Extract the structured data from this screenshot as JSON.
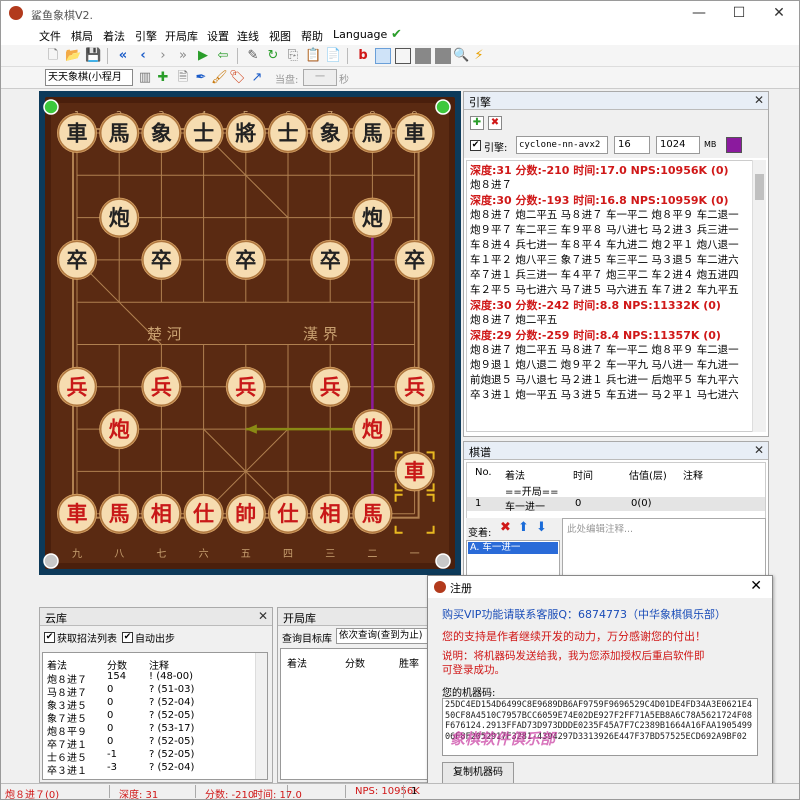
{
  "window": {
    "title": "鲨鱼象棋V2.",
    "colors": {
      "red_text": "#d01818",
      "board": "#5a2a12",
      "board_bg": "#0d3a5a",
      "arrow_purple": "#8b1a9e",
      "arrow_olive": "#8a8a14"
    }
  },
  "menu": {
    "items": [
      "文件",
      "棋局",
      "着法",
      "引擎",
      "开局库",
      "设置",
      "连线",
      "视图",
      "帮助",
      "Language"
    ]
  },
  "toolbar": {
    "icons": [
      "new-file-icon",
      "open-folder-icon",
      "save-icon",
      "first-move-icon",
      "prev-move-icon",
      "next-move-icon",
      "last-move-icon",
      "play-icon",
      "undo-icon",
      "edit-icon",
      "copy-icon",
      "paste-icon",
      "clipboard-icon",
      "bold-b-icon",
      "board-view-icon",
      "layout-icon",
      "panel-icon",
      "grid-icon",
      "search-icon",
      "flash-icon"
    ],
    "mode_select": "天天象棋(小程月",
    "current_label": "当盘:",
    "current_value": "一",
    "seconds_label": "秒"
  },
  "board": {
    "file_numbers_top": [
      "1",
      "2",
      "3",
      "4",
      "5",
      "6",
      "7",
      "8",
      "9"
    ],
    "file_numbers_bottom": [
      "九",
      "八",
      "七",
      "六",
      "五",
      "四",
      "三",
      "二",
      "一"
    ],
    "river_left": "楚  河",
    "river_right": "漢  界",
    "pieces": [
      {
        "name": "black-chariot-left",
        "char": "車",
        "side": "black",
        "file": 0,
        "rank": 0
      },
      {
        "name": "black-horse-left",
        "char": "馬",
        "side": "black",
        "file": 1,
        "rank": 0
      },
      {
        "name": "black-elephant-left",
        "char": "象",
        "side": "black",
        "file": 2,
        "rank": 0
      },
      {
        "name": "black-advisor-left",
        "char": "士",
        "side": "black",
        "file": 3,
        "rank": 0
      },
      {
        "name": "black-general",
        "char": "將",
        "side": "black",
        "file": 4,
        "rank": 0
      },
      {
        "name": "black-advisor-right",
        "char": "士",
        "side": "black",
        "file": 5,
        "rank": 0
      },
      {
        "name": "black-elephant-right",
        "char": "象",
        "side": "black",
        "file": 6,
        "rank": 0
      },
      {
        "name": "black-horse-right",
        "char": "馬",
        "side": "black",
        "file": 7,
        "rank": 0
      },
      {
        "name": "black-chariot-right",
        "char": "車",
        "side": "black",
        "file": 8,
        "rank": 0
      },
      {
        "name": "black-cannon-left",
        "char": "炮",
        "side": "black",
        "file": 1,
        "rank": 2
      },
      {
        "name": "black-cannon-right",
        "char": "炮",
        "side": "black",
        "file": 7,
        "rank": 2
      },
      {
        "name": "black-soldier-1",
        "char": "卒",
        "side": "black",
        "file": 0,
        "rank": 3
      },
      {
        "name": "black-soldier-2",
        "char": "卒",
        "side": "black",
        "file": 2,
        "rank": 3
      },
      {
        "name": "black-soldier-3",
        "char": "卒",
        "side": "black",
        "file": 4,
        "rank": 3
      },
      {
        "name": "black-soldier-4",
        "char": "卒",
        "side": "black",
        "file": 6,
        "rank": 3
      },
      {
        "name": "black-soldier-5",
        "char": "卒",
        "side": "black",
        "file": 8,
        "rank": 3
      },
      {
        "name": "red-soldier-1",
        "char": "兵",
        "side": "red",
        "file": 0,
        "rank": 6
      },
      {
        "name": "red-soldier-2",
        "char": "兵",
        "side": "red",
        "file": 2,
        "rank": 6
      },
      {
        "name": "red-soldier-3",
        "char": "兵",
        "side": "red",
        "file": 4,
        "rank": 6
      },
      {
        "name": "red-soldier-4",
        "char": "兵",
        "side": "red",
        "file": 6,
        "rank": 6
      },
      {
        "name": "red-soldier-5",
        "char": "兵",
        "side": "red",
        "file": 8,
        "rank": 6
      },
      {
        "name": "red-cannon-left",
        "char": "炮",
        "side": "red",
        "file": 1,
        "rank": 7
      },
      {
        "name": "red-cannon-right",
        "char": "炮",
        "side": "red",
        "file": 7,
        "rank": 7
      },
      {
        "name": "red-chariot-moved",
        "char": "車",
        "side": "red",
        "file": 8,
        "rank": 8
      },
      {
        "name": "red-chariot-left",
        "char": "車",
        "side": "red",
        "file": 0,
        "rank": 9
      },
      {
        "name": "red-horse-left",
        "char": "馬",
        "side": "red",
        "file": 1,
        "rank": 9
      },
      {
        "name": "red-elephant-left",
        "char": "相",
        "side": "red",
        "file": 2,
        "rank": 9
      },
      {
        "name": "red-advisor-left",
        "char": "仕",
        "side": "red",
        "file": 3,
        "rank": 9
      },
      {
        "name": "red-king",
        "char": "帥",
        "side": "red",
        "file": 4,
        "rank": 9
      },
      {
        "name": "red-advisor-right",
        "char": "仕",
        "side": "red",
        "file": 5,
        "rank": 9
      },
      {
        "name": "red-elephant-right",
        "char": "相",
        "side": "red",
        "file": 6,
        "rank": 9
      },
      {
        "name": "red-horse-right",
        "char": "馬",
        "side": "red",
        "file": 7,
        "rank": 9
      }
    ],
    "last_move_from": {
      "file": 8,
      "rank": 9
    },
    "last_move_to": {
      "file": 8,
      "rank": 8
    },
    "arrows": [
      {
        "name": "engine-arrow-purple",
        "color": "#8b1a9e",
        "from": {
          "file": 7,
          "rank": 2
        },
        "to": {
          "file": 7,
          "rank": 9
        }
      },
      {
        "name": "engine-arrow-olive",
        "color": "#8a8a14",
        "from": {
          "file": 7,
          "rank": 7
        },
        "to": {
          "file": 4,
          "rank": 7
        }
      }
    ]
  },
  "engine": {
    "title": "引擎",
    "checkbox_label": "引擎:",
    "engine_name": "cyclone-nn-avx2",
    "threads": "16",
    "hash": "1024",
    "hash_unit": "MB",
    "output": [
      {
        "head": "深度:31  分数:-210  时间:17.0  NPS:10956K  (0)",
        "lines": [
          "炮８进７"
        ]
      },
      {
        "head": "深度:30  分数:-193  时间:16.8  NPS:10959K  (0)",
        "lines": [
          "炮８进７ 炮二平五 马８进７ 车一平二 炮８平９ 车二退一",
          "炮９平７ 车二平三 车９平８ 马八进七 马２进３ 兵三进一",
          "车８进４ 兵七进一 车８平４ 车九进二 炮２平１ 炮八退一",
          "车１平２ 炮八平三 象７进５ 车三平二 马３退５ 车二进六",
          "卒７进１ 兵三进一 车４平７ 炮三平二 车２进４ 炮五进四",
          "车２平５ 马七进六 马７进５ 马六进五 车７进２ 车九平五"
        ]
      },
      {
        "head": "深度:30  分数:-242  时间:8.8  NPS:11332K  (0)",
        "lines": [
          "炮８进７ 炮二平五"
        ]
      },
      {
        "head": "深度:29  分数:-259  时间:8.4  NPS:11357K  (0)",
        "lines": [
          "炮８进７ 炮二平五 马８进７ 车一平二 炮８平９ 车二退一",
          "炮９退１ 炮八退二 炮９平２ 车一平九 马八进一 车九进一",
          "前炮退５ 马八退七 马２进１ 兵七进一 后炮平５ 车九平六",
          "卒３进１ 炮一平五 马３进５ 车五进一 马２平１ 马七进六"
        ]
      }
    ]
  },
  "record": {
    "title": "棋谱",
    "columns": [
      "No.",
      "着法",
      "时间",
      "估值(层)",
      "注释"
    ],
    "opening_row": "==开局==",
    "rows": [
      {
        "no": "1",
        "move": "车一进一",
        "time": "0",
        "eval": "0(0)",
        "note": ""
      }
    ],
    "variation_label": "变着:",
    "variation_item": "A. 车一进一",
    "comment_placeholder": "此处编辑注释..."
  },
  "cloud": {
    "title": "云库",
    "checkbox1": "获取招法列表",
    "checkbox2": "自动出步",
    "columns": [
      "着法",
      "分数",
      "注释"
    ],
    "rows": [
      {
        "move": "炮８进７",
        "score": "154",
        "note": "! (48-00)"
      },
      {
        "move": "马８进７",
        "score": "0",
        "note": "? (51-03)"
      },
      {
        "move": "象３进５",
        "score": "0",
        "note": "? (52-04)"
      },
      {
        "move": "象７进５",
        "score": "0",
        "note": "? (52-05)"
      },
      {
        "move": "炮８平９",
        "score": "0",
        "note": "? (53-17)"
      },
      {
        "move": "卒７进１",
        "score": "0",
        "note": "? (52-05)"
      },
      {
        "move": "士６进５",
        "score": "-1",
        "note": "? (52-05)"
      },
      {
        "move": "卒３进１",
        "score": "-3",
        "note": "? (52-04)"
      }
    ]
  },
  "book": {
    "title": "开局库",
    "query_label": "查询目标库",
    "query_mode": "依次查询(查到为止)",
    "columns": [
      "着法",
      "分数",
      "胜率"
    ]
  },
  "registration": {
    "title": "注册",
    "line1": "购买VIP功能请联系客服Q：6874773（中华象棋俱乐部）",
    "line2": "您的支持是作者继续开发的动力，万分感谢您的付出！",
    "line3": "说明：将机器码发送给我，我为您添加授权后重启软件即",
    "line4": "可登录成功。",
    "code_label": "您的机器码:",
    "machine_code": "25DC4ED154D6499C8E9689DB6AF9759F9696529C4D01DE4FD34A3E0621E450CF8A4510C7957BCC6059E74E02DE927F2FF71A5EB8A6C78A5621724F08F676124.2913FFAD73D973DDDE0235F45A7F7C2389B1664A16FAA190549906F8F2052917F3281-4394297D3313926E447F37BD57525ECD692A9BF02",
    "watermark": "象棋软件俱乐部",
    "copy_button": "复制机器码"
  },
  "status": {
    "move": "炮８进７(0)",
    "depth": "深度: 31",
    "score": "分数: -210",
    "time": "时间: 17.0",
    "nps": "NPS: 10956K",
    "extra": "1"
  }
}
